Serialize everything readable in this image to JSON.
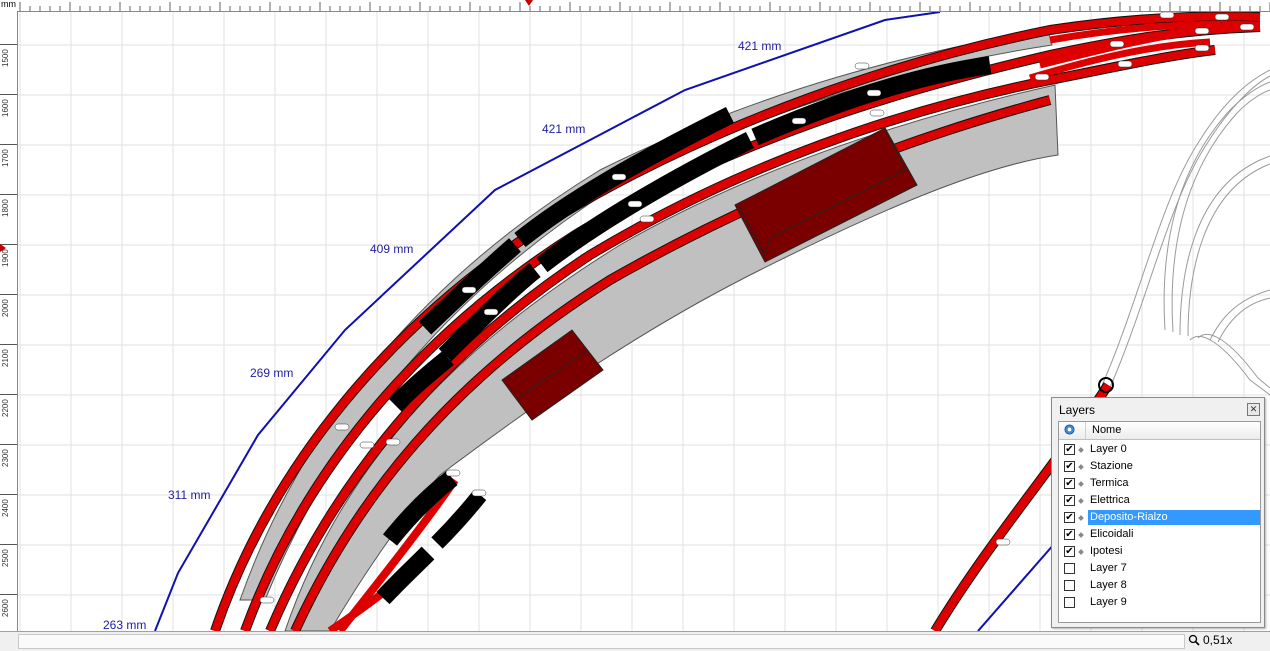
{
  "ruler": {
    "unit": "mm",
    "left_labels": [
      "1500",
      "1600",
      "1700",
      "1800",
      "1900",
      "2000",
      "2100",
      "2200",
      "2300",
      "2400",
      "2500",
      "2600"
    ]
  },
  "dimensions": [
    "421 mm",
    "421 mm",
    "409 mm",
    "269 mm",
    "311 mm",
    "263 mm"
  ],
  "layers_panel": {
    "title": "Layers",
    "column_name": "Nome",
    "close_icon": "close-icon",
    "layers": [
      {
        "name": "Layer 0",
        "visible": true,
        "selected": false
      },
      {
        "name": "Stazione",
        "visible": true,
        "selected": false
      },
      {
        "name": "Termica",
        "visible": true,
        "selected": false
      },
      {
        "name": "Elettrica",
        "visible": true,
        "selected": false
      },
      {
        "name": "Deposito-Rialzo",
        "visible": true,
        "selected": true
      },
      {
        "name": "Elicoidali",
        "visible": true,
        "selected": false
      },
      {
        "name": "Ipotesi",
        "visible": true,
        "selected": false
      },
      {
        "name": "Layer 7",
        "visible": false,
        "selected": false
      },
      {
        "name": "Layer 8",
        "visible": false,
        "selected": false
      },
      {
        "name": "Layer 9",
        "visible": false,
        "selected": false
      }
    ]
  },
  "status": {
    "zoom": "0,51x",
    "zoom_icon": "magnifier-icon"
  },
  "colors": {
    "track": "#dd0000",
    "track_dark": "#111111",
    "platform": "#c0c0c0",
    "building": "#7a0000",
    "dimension": "#1e1ea0",
    "grid": "#e2e2e2",
    "selection": "#3399ff"
  }
}
